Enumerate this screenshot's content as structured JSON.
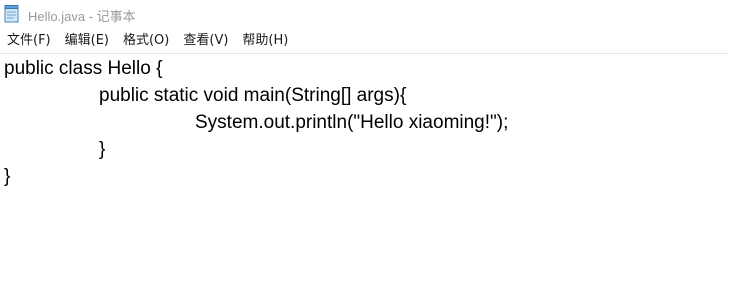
{
  "window": {
    "title": "Hello.java - 记事本",
    "icon": "notepad-icon"
  },
  "menu": {
    "items": [
      {
        "label": "文件(F)"
      },
      {
        "label": "编辑(E)"
      },
      {
        "label": "格式(O)"
      },
      {
        "label": "查看(V)"
      },
      {
        "label": "帮助(H)"
      }
    ]
  },
  "editor": {
    "lines": [
      "public class Hello {",
      "public static void main(String[] args){",
      "System.out.println(\"Hello xiaoming!\");",
      "}",
      "}"
    ]
  }
}
